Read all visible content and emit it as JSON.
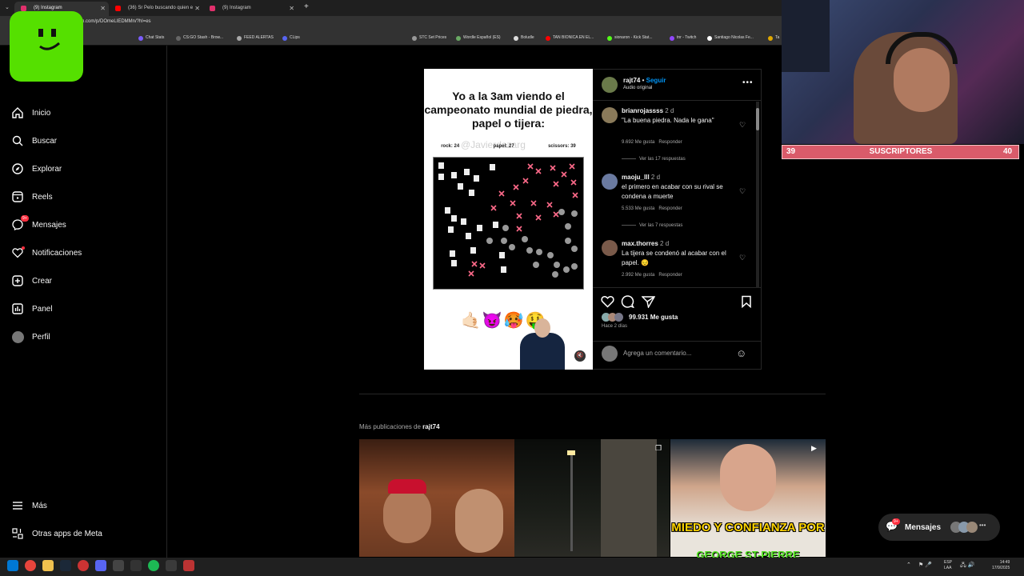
{
  "browser": {
    "tabs": [
      {
        "title": "(9) Instagram",
        "active": true,
        "color": "#e1306c"
      },
      {
        "title": "(36) Sr Pelo buscando quien e",
        "active": false,
        "color": "#ff0000"
      },
      {
        "title": "(9) Instagram",
        "active": false,
        "color": "#e1306c"
      }
    ],
    "new_tab": "+",
    "url": "...am.com/p/DOmeLIEDMMn/?hl=es",
    "bookmarks": [
      "Chat Stats",
      "CS:GO Stash - Brow...",
      "FEED ALERTAS",
      "CLips",
      "STC Set Prices",
      "Wordle Español (ES)",
      "Boludle",
      "TAN BIONICA EN EL...",
      "sionaron - Kick Stat...",
      "tnr - Twitch",
      "Santiago Nicolas Fe...",
      "Ta"
    ]
  },
  "sidebar": {
    "items": [
      {
        "label": "Inicio",
        "icon": "home-icon"
      },
      {
        "label": "Buscar",
        "icon": "search-icon"
      },
      {
        "label": "Explorar",
        "icon": "compass-icon"
      },
      {
        "label": "Reels",
        "icon": "reels-icon"
      },
      {
        "label": "Mensajes",
        "icon": "messenger-icon",
        "badge": "9+"
      },
      {
        "label": "Notificaciones",
        "icon": "heart-icon"
      },
      {
        "label": "Crear",
        "icon": "plus-square-icon"
      },
      {
        "label": "Panel",
        "icon": "dashboard-icon"
      },
      {
        "label": "Perfil",
        "icon": "avatar-icon"
      }
    ],
    "bottom": [
      {
        "label": "Más",
        "icon": "menu-icon"
      },
      {
        "label": "Otras apps de Meta",
        "icon": "meta-apps-icon"
      }
    ]
  },
  "post": {
    "caption": "Yo a la 3am viendo el campeonato mundial de piedra, papel o tijera:",
    "scores": {
      "rock": "rock: 24",
      "paper": "papel: 27",
      "scissors": "scissors: 39"
    },
    "watermark": "@Javierdazarg",
    "emojis": "🤙🏻😈🥵🤑",
    "username": "rajt74",
    "follow": "Seguir",
    "audio": "Audio original",
    "comments": [
      {
        "user": "brianrojassss",
        "time": "2 d",
        "text": "\"La buena piedra. Nada le gana\"",
        "likes": "9.692 Me gusta",
        "reply": "Responder",
        "replies": "Ver las 17 respuestas"
      },
      {
        "user": "maoju_lll",
        "time": "2 d",
        "text": "el primero en acabar con su rival se condena a muerte",
        "likes": "5.533 Me gusta",
        "reply": "Responder",
        "replies": "Ver las 7 respuestas"
      },
      {
        "user": "max.thorres",
        "time": "2 d",
        "text": "La tijera se condenó al acabar con el papel. 😔",
        "likes": "2.992 Me gusta",
        "reply": "Responder"
      }
    ],
    "likes": "99.931 Me gusta",
    "date": "Hace 2 días",
    "add_comment": "Agrega un comentario..."
  },
  "more": {
    "prefix": "Más publicaciones de",
    "user": "rajt74",
    "thumb3_text": "MIEDO Y CONFIANZA POR",
    "thumb3_text2": "GEORGE ST-PIERRE"
  },
  "messages_pill": {
    "label": "Mensajes",
    "badge": "9+"
  },
  "overlay": {
    "subs_left": "39",
    "subs_label": "SUSCRIPTORES",
    "subs_right": "40"
  },
  "system": {
    "lang1": "ESP",
    "lang2": "LAA",
    "time": "14:49",
    "date": "17/9/2025"
  }
}
